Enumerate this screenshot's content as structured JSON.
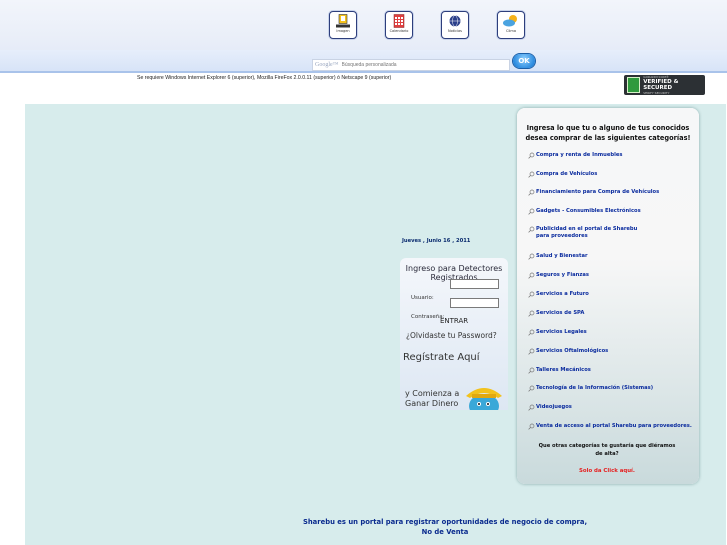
{
  "nav": {
    "icons": [
      {
        "name": "sistema-seguridad",
        "label": "Imagen"
      },
      {
        "name": "calendario",
        "label": "Calendario"
      },
      {
        "name": "noticias",
        "label": "Noticias"
      },
      {
        "name": "clima",
        "label": "Clima"
      }
    ]
  },
  "search": {
    "google_label": "Google™",
    "placeholder": "Búsqueda personalizada",
    "button_label": "OK"
  },
  "requirement_text": "Se requiere Windows Internet Explorer 6 (superior), Mozilla FireFox 2.0.0.11 (superior) ó Netscape 9 (superior)",
  "seal": {
    "top": "GODADDY.COM®",
    "main": "VERIFIED & SECURED",
    "sub": "VERIFY SECURITY"
  },
  "date_text": "Jueves , Junio 16 , 2011",
  "login": {
    "title": "Ingreso para Detectores Registrados",
    "user_label": "Usuario:",
    "password_label": "Contraseña:",
    "enter_label": "ENTRAR",
    "forgot_label": "¿Olvidaste tu Password?",
    "register_label": "Regístrate Aquí",
    "promo_line1": "y Comienza a",
    "promo_line2": "Ganar Dinero"
  },
  "categories": {
    "heading": "Ingresa lo que tu o alguno de tus conocidos desea comprar de las siguientes categorías!",
    "items": [
      {
        "label": "Compra y renta de Inmuebles"
      },
      {
        "label": "Compra de Vehículos"
      },
      {
        "label": "Financiamiento para Compra de Vehículos"
      },
      {
        "label": "Gadgets - Consumibles Electrónicos"
      },
      {
        "label": "Publicidad en el portal de Sharebu para proveedores"
      },
      {
        "label": "Salud y Bienestar"
      },
      {
        "label": "Seguros y Fianzas"
      },
      {
        "label": "Servicios a Futuro"
      },
      {
        "label": "Servicios de SPA"
      },
      {
        "label": "Servicios Legales"
      },
      {
        "label": "Servicios Oftalmológicos"
      },
      {
        "label": "Talleres Mecánicos"
      },
      {
        "label": "Tecnología de la Información (Sistemas)"
      },
      {
        "label": "Videojuegos"
      },
      {
        "label": "Venta de acceso al portal Sharebu para proveedores."
      }
    ],
    "question": "Que otras categorías te gustaría que diéramos de alta?",
    "click_label": "Solo da Click aquí."
  },
  "footer": {
    "line1": "Sharebu es un portal para registrar oportunidades de negocio de compra,",
    "line2": "No de Venta"
  },
  "colors": {
    "panel_bg": "#d7ecec",
    "link_blue": "#0a2b9e",
    "click_red": "#e52020"
  }
}
